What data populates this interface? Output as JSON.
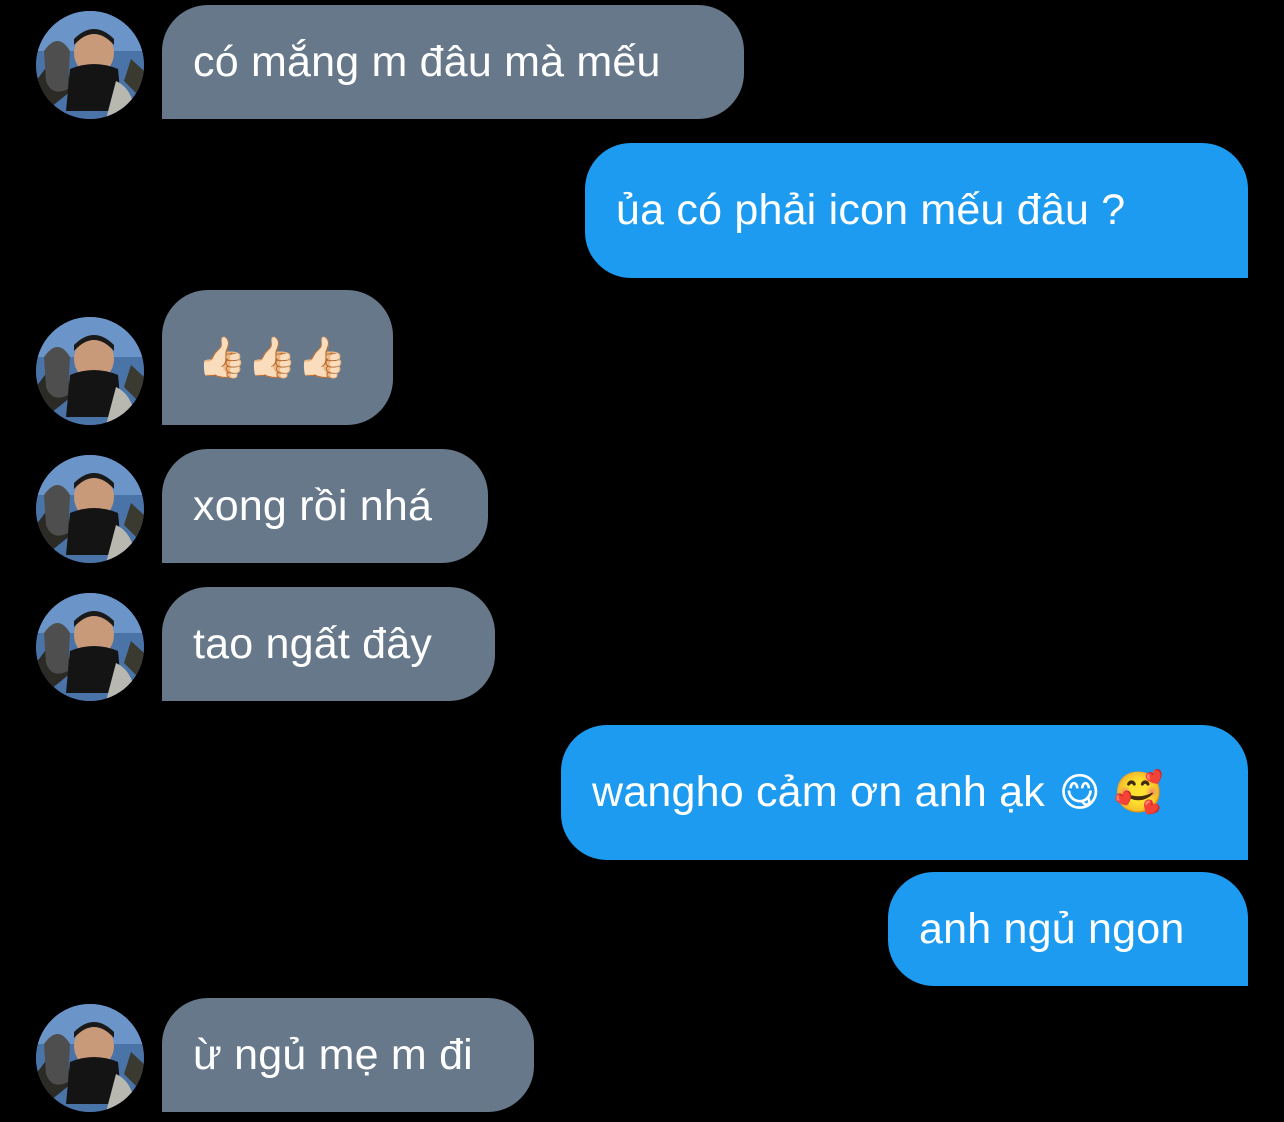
{
  "conversation": {
    "messages": [
      {
        "sender": "them",
        "text": "có mắng m đâu mà mếu"
      },
      {
        "sender": "me",
        "text": "ủa có phải icon mếu đâu  ?"
      },
      {
        "sender": "them",
        "text": "👍🏻👍🏻👍🏻"
      },
      {
        "sender": "them",
        "text": "xong rồi nhá"
      },
      {
        "sender": "them",
        "text": "tao ngất đây"
      },
      {
        "sender": "me",
        "text": "wangho cảm ơn anh ạk",
        "emojis": "😋 🥰"
      },
      {
        "sender": "me",
        "text": "anh ngủ ngon"
      },
      {
        "sender": "them",
        "text": "ừ ngủ mẹ m đi"
      }
    ]
  },
  "colors": {
    "background": "#000000",
    "incoming_bubble": "#66788a",
    "outgoing_bubble": "#1d9bf0",
    "text": "#ffffff"
  },
  "icons": {
    "avatar": "contact-avatar-photo"
  }
}
